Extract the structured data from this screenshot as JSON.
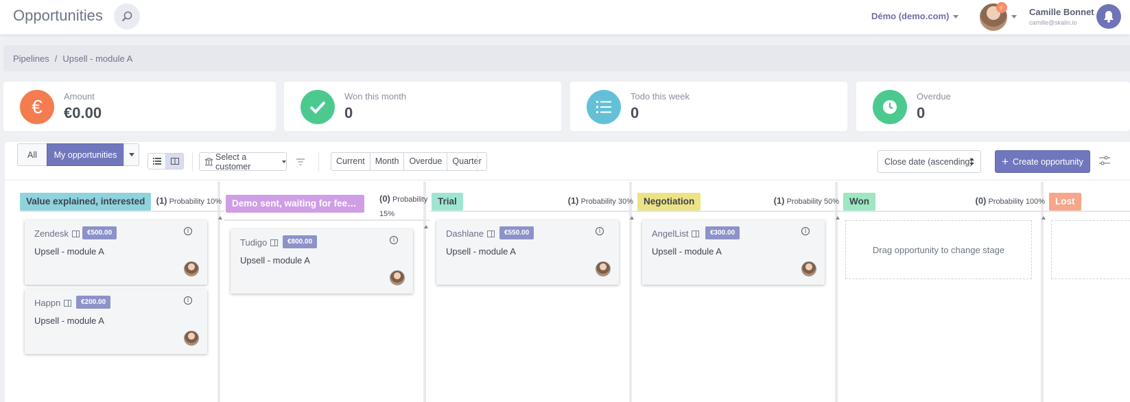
{
  "header": {
    "title": "Opportunities",
    "search_icon": "search-icon",
    "organization": "Démo (demo.com)",
    "user_name": "Camille Bonnet",
    "user_email": "camille@skalin.io",
    "notification_icon": "bell-icon"
  },
  "breadcrumb": {
    "items": [
      "Pipelines",
      "Upsell - module A"
    ],
    "separator": "/"
  },
  "stats": [
    {
      "label": "Amount",
      "value": "€0.00",
      "icon": "euro-icon",
      "icon_glyph": "€",
      "color": "#f47c4f"
    },
    {
      "label": "Won this month",
      "value": "0",
      "icon": "check-icon",
      "icon_glyph": "✔",
      "color": "#4cc98f"
    },
    {
      "label": "Todo this week",
      "value": "0",
      "icon": "list-icon",
      "icon_glyph": "☰",
      "color": "#64c0d7"
    },
    {
      "label": "Overdue",
      "value": "0",
      "icon": "clock-icon",
      "icon_glyph": "◷",
      "color": "#4cc98f"
    }
  ],
  "toolbar": {
    "filter_all": "All",
    "filter_mine": "My opportunities",
    "customer_select": "Select a customer",
    "periods": [
      "Current",
      "Month",
      "Overdue",
      "Quarter"
    ],
    "sort": "Close date (ascending)",
    "create_button": "Create opportunity"
  },
  "stages": [
    {
      "name": "Value explained, interested",
      "count": "(1)",
      "probability": "Probability 10%",
      "color": "#8fd3dc",
      "cards": [
        {
          "company": "Zendesk",
          "amount": "€500.00",
          "title": "Upsell - module A"
        },
        {
          "company": "Happn",
          "amount": "€200.00",
          "title": "Upsell - module A"
        }
      ]
    },
    {
      "name": "Demo sent, waiting for feed...",
      "count": "(0)",
      "probability": "Probability 15%",
      "color": "#cf9ee6",
      "cards": [
        {
          "company": "Tudigo",
          "amount": "€800.00",
          "title": "Upsell - module A"
        }
      ]
    },
    {
      "name": "Trial",
      "count": "(1)",
      "probability": "Probability 30%",
      "color": "#9fe6d2",
      "cards": [
        {
          "company": "Dashlane",
          "amount": "€550.00",
          "title": "Upsell - module A"
        }
      ]
    },
    {
      "name": "Negotiation",
      "count": "(1)",
      "probability": "Probability 50%",
      "color": "#ece385",
      "cards": [
        {
          "company": "AngelList",
          "amount": "€300.00",
          "title": "Upsell - module A"
        }
      ]
    },
    {
      "name": "Won",
      "count": "(0)",
      "probability": "Probability 100%",
      "color": "#9fe6c2",
      "cards": [],
      "empty_text": "Drag opportunity to change stage"
    },
    {
      "name": "Lost",
      "color": "#f6a68a"
    }
  ]
}
